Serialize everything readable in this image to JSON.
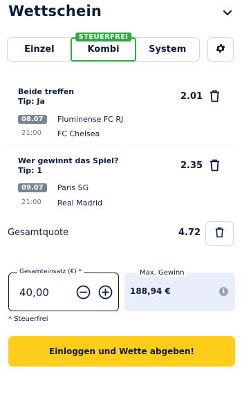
{
  "header": {
    "title": "Wettschein",
    "collapse_icon": "chevron-down-icon"
  },
  "tabs": [
    {
      "label": "Einzel",
      "active": false
    },
    {
      "label": "Kombi",
      "active": true,
      "badge": "STEUERFREI"
    },
    {
      "label": "System",
      "active": false
    }
  ],
  "settings_icon": "gear-icon",
  "bets": [
    {
      "market": "Beide treffen",
      "tip": "Tip: Ja",
      "odds": "2.01",
      "date": "08.07",
      "time": "21:00",
      "home": "Fluminense FC RJ",
      "away": "FC Chelsea"
    },
    {
      "market": "Wer gewinnt das Spiel?",
      "tip": "Tip: 1",
      "odds": "2.35",
      "date": "09.07",
      "time": "21:00",
      "home": "Paris SG",
      "away": "Real Madrid"
    }
  ],
  "total": {
    "label": "Gesamtquote",
    "value": "4.72"
  },
  "stake": {
    "label": "Gesamteinsatz (€) *",
    "value": "40,00"
  },
  "max_win": {
    "label": "Max. Gewinn",
    "value": "188,94 €",
    "info_icon": "i"
  },
  "footnote": "* Steuerfrei",
  "submit_label": "Einloggen und Wette abgeben!",
  "colors": {
    "accent_green": "#2eaa3f",
    "submit_yellow": "#ffcd1a",
    "text_navy": "#0b1c3d",
    "win_bg": "#eaeefb"
  }
}
